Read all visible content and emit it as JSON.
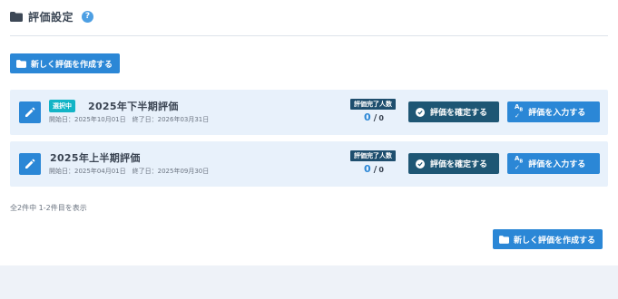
{
  "header": {
    "title": "評価設定",
    "help": "?"
  },
  "create_button_label": "新しく評価を作成する",
  "evaluations": [
    {
      "badge": "選択中",
      "name": "2025年下半期評価",
      "dates": "開始日：2025年10月01日　終了日：2026年03月31日",
      "count_label": "評価完了人数",
      "completed": "0",
      "slash": "/",
      "total": "0",
      "confirm_label": "評価を確定する",
      "input_label": "評価を入力する"
    },
    {
      "badge": "",
      "name": "2025年上半期評価",
      "dates": "開始日：2025年04月01日　終了日：2025年09月30日",
      "count_label": "評価完了人数",
      "completed": "0",
      "slash": "/",
      "total": "0",
      "confirm_label": "評価を確定する",
      "input_label": "評価を入力する"
    }
  ],
  "summary": "全2件中 1-2件目を表示",
  "icons": {
    "folder": "folder-icon",
    "edit": "pencil-icon",
    "confirm": "check-circle-icon",
    "input": "spellcheck-icon",
    "help": "help-icon"
  },
  "colors": {
    "primary": "#2b87d6",
    "dark": "#1e5674",
    "badge": "#12b4c6",
    "card": "#e8f1fb"
  }
}
